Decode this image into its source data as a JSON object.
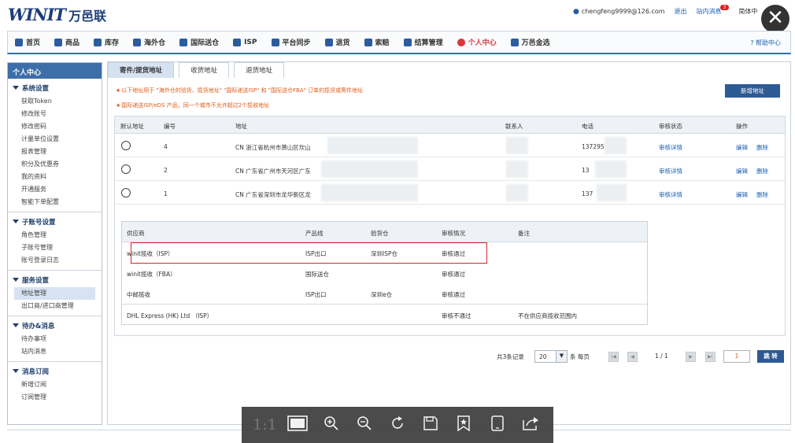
{
  "header": {
    "logo_mark": "WINIT",
    "logo_cn": "万邑联",
    "user_email": "chengfeng9999@126.com",
    "logout": "退出",
    "messages_label": "站内消息",
    "messages_count": "3",
    "language": "简体中",
    "close_glyph": "✕"
  },
  "nav": {
    "items": [
      "首页",
      "商品",
      "库存",
      "海外仓",
      "国际送仓",
      "ISP",
      "平台同步",
      "退货",
      "索赔",
      "结算管理",
      "个人中心",
      "万邑金选"
    ],
    "active_index": 10,
    "help": "帮助中心"
  },
  "sidebar": {
    "title": "个人中心",
    "groups": [
      {
        "title": "系统设置",
        "links": [
          "获取Token",
          "修改账号",
          "修改密码",
          "计量单位设置",
          "报表管理",
          "积分及优惠券",
          "我的资料",
          "开通服务",
          "智能下单配置"
        ]
      },
      {
        "title": "子账号设置",
        "links": [
          "角色管理",
          "子账号管理",
          "账号登录日志"
        ]
      },
      {
        "title": "服务设置",
        "links": [
          "地址管理",
          "出口商/进口商管理"
        ],
        "selected": "地址管理"
      },
      {
        "title": "待办&消息",
        "links": [
          "待办事项",
          "站内消息"
        ]
      },
      {
        "title": "消息订阅",
        "links": [
          "新增订阅",
          "订阅管理"
        ]
      }
    ]
  },
  "tabs": [
    "寄件/提货地址",
    "收货地址",
    "退货地址"
  ],
  "notes": [
    "以下地址用于 \"海外仓的验货、揽货地址\" \"国际递送ISP\" 和 \"国际送仓FBA\" 订单的揽货或寄件地址",
    "国际递送ISP/eDS 产品，同一个城市不允许超过2个揽收地址"
  ],
  "add_button": "新增地址",
  "table": {
    "headers": [
      "默认地址",
      "编号",
      "地址",
      "联系人",
      "电话",
      "审核状态",
      "操作"
    ],
    "rows": [
      {
        "id": "4",
        "address": "CN 浙江省杭州市萧山区坎山",
        "phone": "137295",
        "status": "审核详情",
        "edit": "编辑",
        "delete": "删除"
      },
      {
        "id": "2",
        "address": "CN 广东省广州市天河区广东",
        "phone": "13",
        "status": "审核详情",
        "edit": "编辑",
        "delete": "删除"
      },
      {
        "id": "1",
        "address": "CN 广东省深圳市龙华新区龙",
        "phone": "137",
        "status": "审核详情",
        "edit": "编辑",
        "delete": "删除"
      }
    ]
  },
  "sub_table": {
    "headers": [
      "供应商",
      "产品线",
      "验货仓",
      "审核情况",
      "备注"
    ],
    "rows": [
      {
        "supplier": "winit揽收（ISP）",
        "product": "ISP出口",
        "warehouse": "深圳ISP仓",
        "review": "审核通过",
        "remark": ""
      },
      {
        "supplier": "winit揽收（FBA）",
        "product": "国际送仓",
        "warehouse": "",
        "review": "审核通过",
        "remark": ""
      },
      {
        "supplier": "中邮揽收",
        "product": "ISP出口",
        "warehouse": "深圳e仓",
        "review": "审核通过",
        "remark": ""
      },
      {
        "supplier": "DHL Express (HK) Ltd （ISP）",
        "product": "",
        "warehouse": "",
        "review": "审核不通过",
        "remark": "不在供应商揽收范围内"
      }
    ]
  },
  "pager": {
    "total": "共3条记录",
    "page_size": "20",
    "per_page": "条 每页",
    "current": "1 / 1",
    "page_input": "1",
    "jump": "跳 转"
  },
  "viewer_toolbar": {
    "ratio": "1:1",
    "tools": [
      "fit-screen",
      "zoom-in",
      "zoom-out",
      "rotate",
      "save",
      "bookmark",
      "tablet",
      "share"
    ]
  }
}
